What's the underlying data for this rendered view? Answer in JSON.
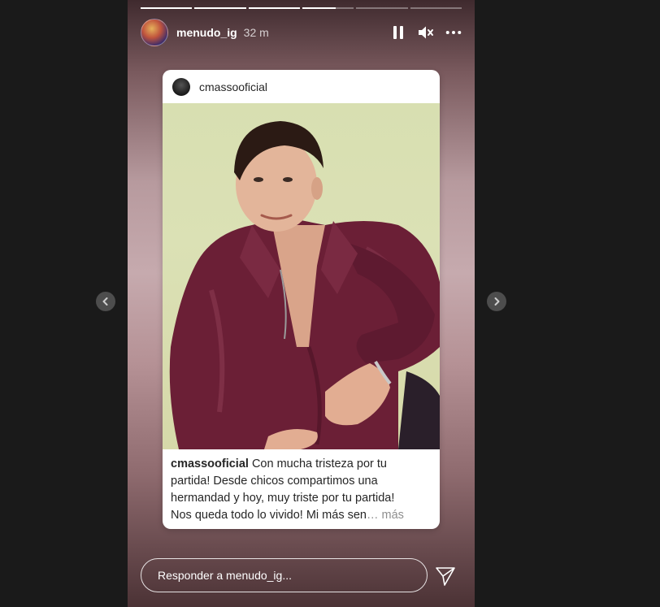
{
  "story": {
    "username": "menudo_ig",
    "time": "32 m",
    "progress": [
      1,
      1,
      1,
      0.65,
      0,
      0
    ],
    "icons": {
      "pause": "pause-icon",
      "mute": "mute-icon",
      "more": "more-options-icon",
      "prev": "chevron-left-icon",
      "next": "chevron-right-icon",
      "send": "send-icon"
    }
  },
  "card": {
    "username": "cmassooficial",
    "caption_user": "cmassooficial",
    "caption_lines": [
      "Con mucha tristeza por tu",
      "partida!  Desde chicos compartimos  una",
      "hermandad y hoy, muy triste por tu partida!",
      "Nos queda todo lo vivido! Mi más sen"
    ],
    "ellipsis": "…",
    "more_label": "más"
  },
  "reply": {
    "placeholder": "Responder a menudo_ig..."
  },
  "colors": {
    "shirt": "#6b1f36",
    "photo_bg": "#d8dfb1"
  }
}
